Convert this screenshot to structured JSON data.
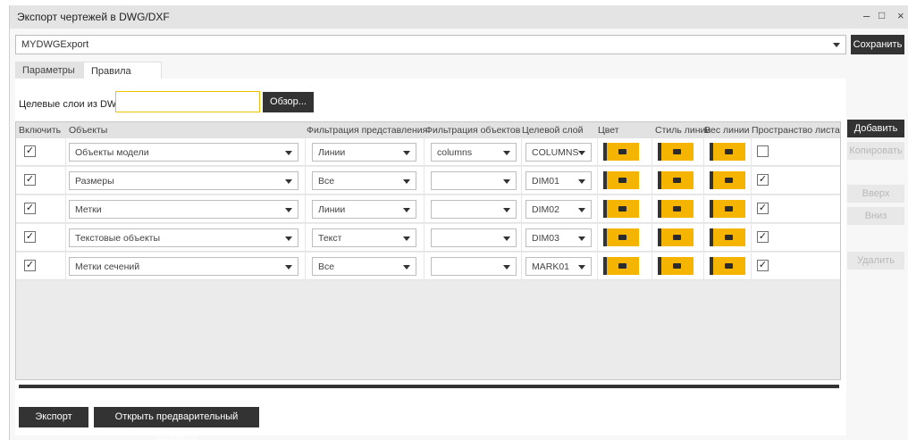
{
  "window": {
    "title": "Экспорт чертежей в DWG/DXF",
    "minimize": "–",
    "maximize": "□",
    "close": "×"
  },
  "profile": {
    "value": "MYDWGExport",
    "save_label": "Сохранить"
  },
  "tabs": [
    {
      "label": "Параметры"
    },
    {
      "label": "Правила слоя"
    }
  ],
  "target_layers": {
    "label": "Целевые слои из DWG",
    "value": "",
    "browse_label": "Обзор..."
  },
  "table": {
    "headers": {
      "enable": "Включить",
      "objects": "Объекты",
      "view_filter": "Фильтрация представления",
      "object_filter": "Фильтрация объектов",
      "target_layer": "Целевой слой",
      "color": "Цвет",
      "linestyle": "Стиль линии",
      "lineweight": "Вес линии",
      "paperspace": "Пространство листа"
    },
    "rows": [
      {
        "enabled": "✓",
        "object": "Объекты модели",
        "view_filter": "Линии",
        "object_filter": "columns",
        "target_layer": "COLUMNS",
        "paperspace": ""
      },
      {
        "enabled": "✓",
        "object": "Размеры",
        "view_filter": "Все",
        "object_filter": "",
        "target_layer": "DIM01",
        "paperspace": "✓"
      },
      {
        "enabled": "✓",
        "object": "Метки",
        "view_filter": "Линии",
        "object_filter": "",
        "target_layer": "DIM02",
        "paperspace": "✓"
      },
      {
        "enabled": "✓",
        "object": "Текстовые объекты",
        "view_filter": "Текст",
        "object_filter": "",
        "target_layer": "DIM03",
        "paperspace": "✓"
      },
      {
        "enabled": "✓",
        "object": "Метки сечений",
        "view_filter": "Все",
        "object_filter": "",
        "target_layer": "MARK01",
        "paperspace": "✓"
      }
    ]
  },
  "side_buttons": {
    "add": "Добавить",
    "copy": "Копировать",
    "up": "Вверх",
    "down": "Вниз",
    "delete": "Удалить"
  },
  "bottom": {
    "export_label": "Экспорт",
    "preview_label": "Открыть предварительный просмотр"
  },
  "colors": {
    "swatch": "#f4b400",
    "dark_button": "#333333",
    "input_focus": "#f2c200"
  }
}
